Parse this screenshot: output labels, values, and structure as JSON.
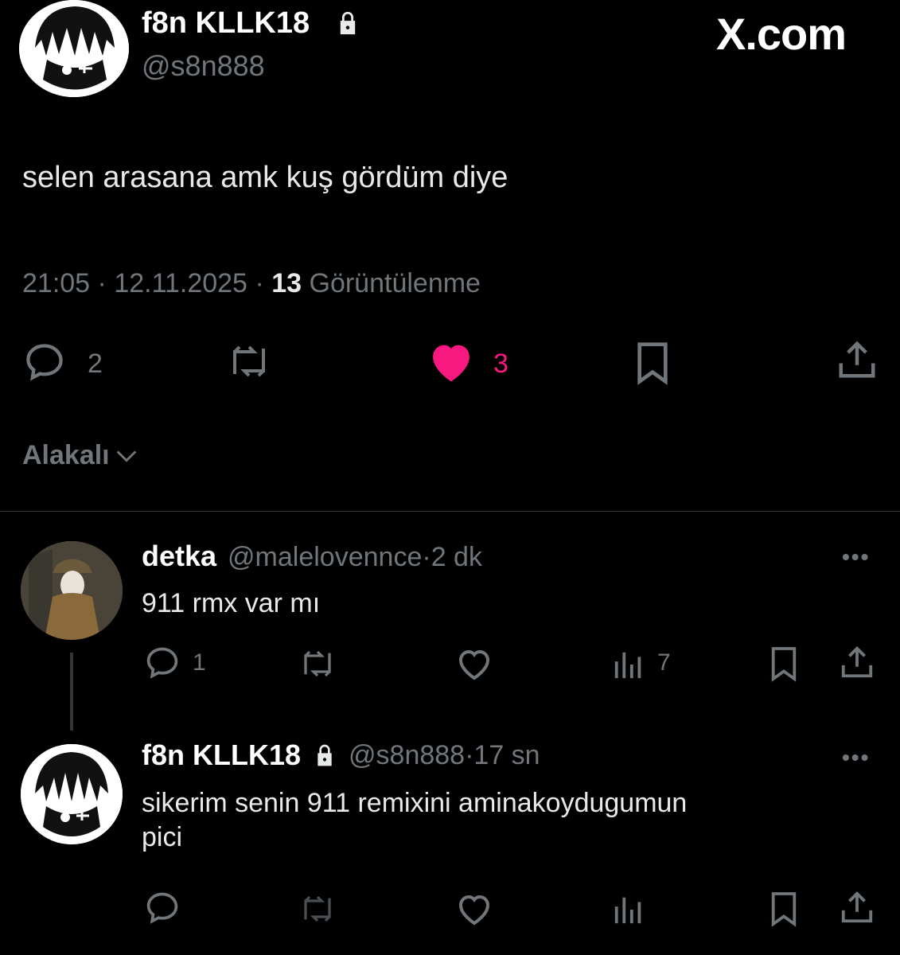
{
  "brand": "X.com",
  "tweet": {
    "author_name": "f8n KLLK18",
    "author_handle": "@s8n888",
    "text": "selen arasana amk kuş gördüm diye",
    "time": "21:05",
    "date": "12.11.2025",
    "views_count": "13",
    "views_label": "Görüntülenme",
    "reply_count": "2",
    "like_count": "3"
  },
  "sort": {
    "label": "Alakalı"
  },
  "replies": [
    {
      "author_name": "detka",
      "author_handle": "@malelovennce",
      "age": "2 dk",
      "text": "911 rmx var mı",
      "reply_count": "1",
      "view_count": "7"
    },
    {
      "author_name": "f8n KLLK18",
      "author_handle": "@s8n888",
      "age": "17 sn",
      "text_line1": "sikerim senin 911 remixini aminakoydugumun",
      "text_line2": "pici"
    }
  ],
  "colors": {
    "like": "#f91880",
    "muted": "#71767b",
    "text": "#e7e9ea",
    "background": "#000000"
  }
}
